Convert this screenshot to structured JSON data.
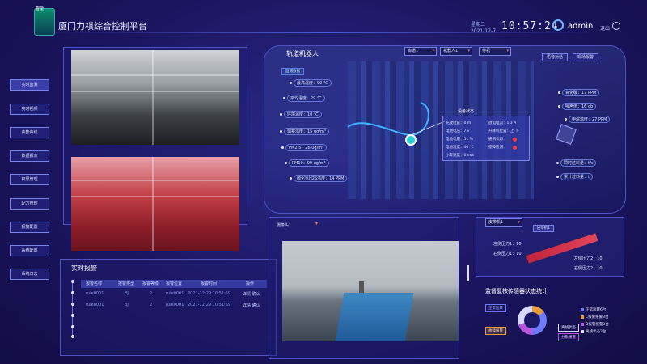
{
  "header": {
    "logo_text": "智能",
    "title": "厦门力祺综合控制平台",
    "weekday": "星期二",
    "date": "2021-12-7",
    "clock": "10:57:24",
    "username": "admin",
    "logout": "退出"
  },
  "nav": {
    "items": [
      "实时监测",
      "实时视频",
      "曲势曲线",
      "数据报表",
      "权限管理",
      "配方管理",
      "报警配置",
      "系统配置",
      "系统日志"
    ]
  },
  "alarm": {
    "title": "实时报警",
    "columns": [
      "报警名称",
      "报警类型",
      "报警等级",
      "报警位置",
      "报警时间",
      "操作"
    ],
    "rows": [
      {
        "name": "rule0001",
        "type": "BJ",
        "level": "2",
        "position": "rule0001",
        "time": "2021-12-29 10:51:59",
        "op": "详情 确认"
      },
      {
        "name": "rule0001",
        "type": "BJ",
        "level": "2",
        "position": "rule0001",
        "time": "2021-12-29 10:51:59",
        "op": "详情 确认"
      }
    ]
  },
  "robot": {
    "title": "轨道机器人",
    "selects": [
      "廊道1",
      "机器人1",
      "待机"
    ],
    "buttons": [
      "语音对话",
      "现场报警"
    ],
    "monitor_tag": "监测数据",
    "left_sensors": [
      "最高温度：90 ℃",
      "平均温度：29 ℃",
      "环境温度：10 ℃",
      "烟雾浓度：15 ug/m³",
      "PM2.5：26 ug/m³",
      "PM10：99 ug/m³",
      "硫化氢H2S浓度：14 PPM"
    ],
    "right_sensors": [
      "氧化碳：17 PPM",
      "噪声值：16 db",
      "甲烷浓度：27 PPM",
      "瞬时过料量：t/s",
      "累计过料量：t"
    ],
    "status": {
      "title": "设备状态",
      "left": [
        "充放位置：0 m",
        "电池电压：7 v",
        "电池电量：51 %",
        "电池温度：40 ℃",
        "小车速度：0 m/s"
      ],
      "right": [
        "放电电流：1.3 A",
        "升降机位置：上 下",
        "通讯状态：",
        "壁障检测："
      ]
    }
  },
  "camera": {
    "label": "摄像头1"
  },
  "conveyor": {
    "select": "皮带机1",
    "button": "皮带机1",
    "left_top": "左侧压力1：10",
    "right_top": "右侧压力1：10",
    "left_bottom": "左侧压力2：10",
    "right_bottom": "右侧压力2：10"
  },
  "sensor_stats": {
    "title": "监督复核传感器状态统计",
    "tags": [
      "正常运转",
      "故障报警",
      "离线状态",
      "分散报警"
    ],
    "legend": [
      "正常运转6台",
      "C报警报警3台",
      "D报警报警3台",
      "离线状态3台"
    ],
    "shares": [
      0.15,
      0.35,
      0.2,
      0.3
    ],
    "colors": [
      "#e89b3a",
      "#6e7bff",
      "#b855e0",
      "#d9d9ff"
    ]
  }
}
